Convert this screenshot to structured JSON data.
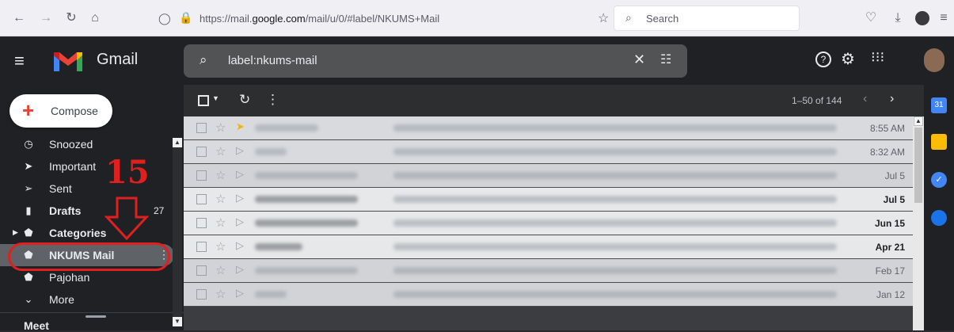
{
  "browser": {
    "url_prefix": "https://mail.",
    "url_host": "google.com",
    "url_suffix": "/mail/u/0/#label/NKUMS+Mail",
    "search_placeholder": "Search"
  },
  "header": {
    "app_name": "Gmail",
    "search_query": "label:nkums-mail"
  },
  "sidebar": {
    "compose_label": "Compose",
    "items": [
      {
        "label": "Snoozed",
        "icon": "clock-icon"
      },
      {
        "label": "Important",
        "icon": "important-icon"
      },
      {
        "label": "Sent",
        "icon": "send-icon"
      },
      {
        "label": "Drafts",
        "icon": "draft-icon",
        "count": "27"
      },
      {
        "label": "Categories",
        "icon": "label-icon"
      },
      {
        "label": "NKUMS Mail",
        "icon": "label-icon"
      },
      {
        "label": "Pajohan",
        "icon": "label-icon"
      },
      {
        "label": "More",
        "icon": "chevron-down-icon"
      }
    ],
    "meet_label": "Meet"
  },
  "toolbar": {
    "pagination": "1–50 of 144"
  },
  "emails": [
    {
      "date": "8:55 AM",
      "unread": false,
      "important": true
    },
    {
      "date": "8:32 AM",
      "unread": false,
      "important": false
    },
    {
      "date": "Jul 5",
      "unread": false,
      "important": false
    },
    {
      "date": "Jul 5",
      "unread": true,
      "important": false
    },
    {
      "date": "Jun 15",
      "unread": true,
      "important": false
    },
    {
      "date": "Apr 21",
      "unread": true,
      "important": false
    },
    {
      "date": "Feb 17",
      "unread": false,
      "important": false
    },
    {
      "date": "Jan 12",
      "unread": false,
      "important": false
    }
  ],
  "annotation": {
    "number": "15"
  },
  "colors": {
    "annotation": "#e0201f",
    "important_marker": "#f4b400"
  }
}
